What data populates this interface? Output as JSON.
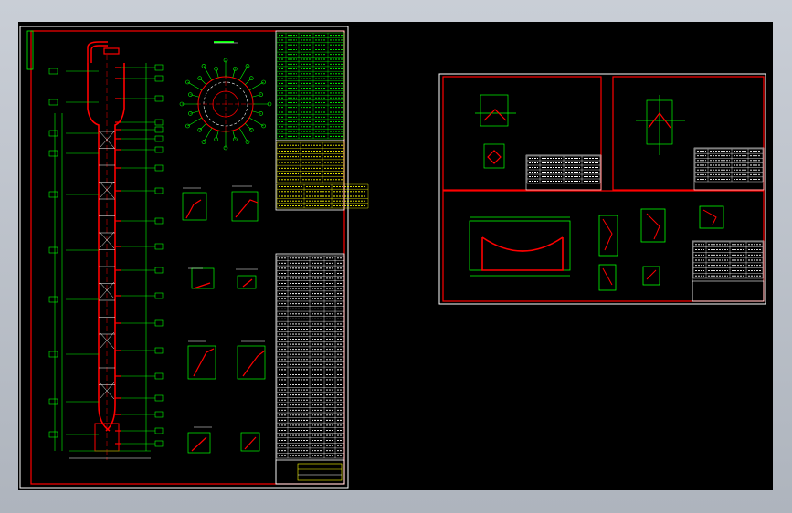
{
  "window": {
    "title": ""
  },
  "colors": {
    "background": "#000000",
    "frame": "#ffffff",
    "vessel": "#ff0000",
    "dimension": "#00ff00",
    "table_accent": "#ffff00",
    "annotation": "#ffffff"
  },
  "sheets": [
    {
      "name": "tower-assembly-sheet"
    },
    {
      "name": "detail-sheet-top-left"
    },
    {
      "name": "detail-sheet-top-right"
    },
    {
      "name": "detail-sheet-bottom"
    }
  ],
  "icons": [
    "cad-drawing"
  ]
}
